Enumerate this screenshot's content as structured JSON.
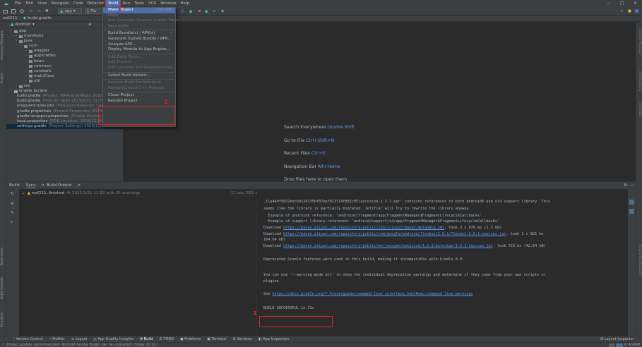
{
  "menubar": {
    "items": [
      "File",
      "Edit",
      "View",
      "Navigate",
      "Code",
      "Refactor",
      "Build",
      "Run",
      "Tools",
      "VCS",
      "Window",
      "Help"
    ],
    "active": "Build",
    "window_controls": [
      "—",
      "□",
      "✕"
    ]
  },
  "toolbar": {
    "run_config": "app",
    "device": "Pix"
  },
  "breadcrumb": {
    "project": "wxf211",
    "file": "build.gradle"
  },
  "project_panel": {
    "view": "Android",
    "tree": [
      {
        "label": "app",
        "depth": 0,
        "icon": "folder"
      },
      {
        "label": "manifests",
        "depth": 1,
        "icon": "folder"
      },
      {
        "label": "java",
        "depth": 1,
        "icon": "folder"
      },
      {
        "label": "com",
        "depth": 2,
        "icon": "package"
      },
      {
        "label": "adapter",
        "depth": 3,
        "icon": "package"
      },
      {
        "label": "application",
        "depth": 3,
        "icon": "package"
      },
      {
        "label": "bean",
        "depth": 3,
        "icon": "package"
      },
      {
        "label": "common",
        "depth": 3,
        "icon": "package"
      },
      {
        "label": "constant",
        "depth": 3,
        "icon": "package"
      },
      {
        "label": "mainClass",
        "depth": 3,
        "icon": "package"
      },
      {
        "label": "util",
        "depth": 3,
        "icon": "package"
      },
      {
        "label": "res",
        "depth": 1,
        "icon": "folder"
      },
      {
        "label": "Gradle Scripts",
        "depth": 0,
        "icon": "gradle"
      },
      {
        "label": "build.gradle",
        "depth": 1,
        "icon": "gradle",
        "note": "(Project: WRAndroidApp)  2025/1/21 12:53, 457 B"
      },
      {
        "label": "build.gradle",
        "depth": 1,
        "icon": "gradle",
        "note": "(Module :app)  2025/1/21 12:28, 5.51 kB  Moments"
      },
      {
        "label": "proguard-rules.pro",
        "depth": 1,
        "icon": "file",
        "note": "(ProGuard Rules for \":app\")  2024/11/26 11:28"
      },
      {
        "label": "gradle.properties",
        "depth": 1,
        "icon": "props",
        "note": "(Project Properties)  2024/11/26 11:58, 147 B"
      },
      {
        "label": "gradle-wrapper.properties",
        "depth": 1,
        "icon": "props",
        "note": "(Gradle Version)  2024/11/26 11:58"
      },
      {
        "label": "local.properties",
        "depth": 1,
        "icon": "props",
        "note": "(SDK Location)  2024/12/16 16:02, 468 B"
      },
      {
        "label": "settings.gradle",
        "depth": 1,
        "icon": "gradle",
        "note": "(Project Settings)  2025/1/21 12:31, 460 B  Moment",
        "selected": true
      }
    ]
  },
  "build_menu": {
    "items": [
      {
        "label": "Make Project",
        "shortcut": "Ctrl+F9",
        "enabled": true,
        "highlighted": true
      },
      {
        "label": "Make",
        "enabled": false
      },
      {
        "label": "Run Generate Sources Gradle Tasks",
        "enabled": false
      },
      {
        "label": "Recompile",
        "enabled": false
      },
      {
        "sep": true
      },
      {
        "label": "Build Bundle(s) / APK(s)",
        "enabled": true,
        "submenu": true
      },
      {
        "label": "Generate Signed Bundle / APK...",
        "enabled": true
      },
      {
        "label": "Analyze APK...",
        "enabled": true
      },
      {
        "label": "Deploy Module to App Engine...",
        "enabled": true
      },
      {
        "sep": true
      },
      {
        "label": "Edit Build Types...",
        "enabled": false
      },
      {
        "label": "Edit Flavors...",
        "enabled": false
      },
      {
        "label": "Edit Libraries and Dependencies...",
        "enabled": false
      },
      {
        "sep": true
      },
      {
        "label": "Select Build Variant...",
        "enabled": true
      },
      {
        "sep": true
      },
      {
        "label": "Analyze Build Performance",
        "enabled": false
      },
      {
        "label": "Refresh Linked C++ Projects",
        "enabled": false
      },
      {
        "sep": true
      },
      {
        "label": "Clean Project",
        "enabled": true
      },
      {
        "label": "Rebuild Project",
        "enabled": true
      }
    ]
  },
  "editor_hints": [
    {
      "text": "Search Everywhere",
      "key": "Double Shift"
    },
    {
      "text": "Go to File",
      "key": "Ctrl+Shift+N"
    },
    {
      "text": "Recent Files",
      "key": "Ctrl+E"
    },
    {
      "text": "Navigation Bar",
      "key": "Alt+Home"
    },
    {
      "text": "Drop files here to open them",
      "key": ""
    }
  ],
  "build_panel": {
    "tabs": [
      "Build:",
      "Sync",
      "Build Output"
    ],
    "tree_item": "wxf211: finished",
    "tree_item_detail": "At 2025/1/21 12:53 with 35 warnings",
    "tree_item_time": "11 sec, 851 ms"
  },
  "console": {
    "lines": [
      {
        "text": ".1\\a44df9822edcb9124235bf07bef813714fd81c05\\autosize-1.2.1.aar' contains references to both AndroidX and old support library. This"
      },
      {
        "text": "seems like the library is partially migrated. Jetifier will try to rewrite the library anyway."
      },
      {
        "text": "  Example of androidX reference: 'androidx/fragment/app/FragmentManager$FragmentLifecycleCallbacks'"
      },
      {
        "text": "  Example of support library reference: 'android/support/v4/app/FragmentManager$FragmentLifecycleCallbacks'"
      },
      {
        "pre": "Download ",
        "link": "https://maven.aliyun.com/repository/public/junit/junit/maven-metadata.xml",
        "post": ", took 3 s 970 ms (1.3 kB)"
      },
      {
        "pre": "Download ",
        "link": "https://maven.aliyun.com/repository/public/com/google/android/flexbox/2.0.1/flexbox-2.0.1-sources.jar",
        "post": ", took 1 s 921 ms"
      },
      {
        "text": "(64.04 kB)"
      },
      {
        "pre": "Download ",
        "link": "https://maven.aliyun.com/repository/public/me/jessyan/autosize/1.2.1/autosize-1.2.1-sources.jar",
        "post": ", took 723 ms (42.64 kB)"
      },
      {
        "text": ""
      },
      {
        "text": "Deprecated Gradle features were used in this build, making it incompatible with Gradle 8.0."
      },
      {
        "text": ""
      },
      {
        "text": "You can use '--warning-mode all' to show the individual deprecation warnings and determine if they come from your own scripts or"
      },
      {
        "text": "plugins."
      },
      {
        "text": ""
      },
      {
        "pre": "See ",
        "link": "https://docs.gradle.org/7.4/userguide/command_line_interface.html#sec:command_line_warnings",
        "post": ""
      },
      {
        "text": ""
      },
      {
        "text": "BUILD SUCCESSFUL in 31s"
      }
    ]
  },
  "bottom_tabs": [
    "Version Control",
    "Profiler",
    "Logcat",
    "App Quality Insights",
    "Build",
    "TODO",
    "Problems",
    "Terminal",
    "Services",
    "App Inspection"
  ],
  "bottom_right": "Layout Inspector",
  "status": {
    "message": "Project update recommended: Android Gradle Plugin can be upgraded. (today 10:21)",
    "right": "of 4096M"
  },
  "annotations": [
    "1",
    "2",
    "3"
  ],
  "left_strip": [
    "Resource Manager",
    "Project",
    "Bookmarks",
    "Build Variants",
    "Structure"
  ],
  "right_strip": [
    "Device Manager",
    "Notifications",
    "Emulator",
    "Device File Explorer"
  ],
  "colors": {
    "accent": "#4b6eaf",
    "annotation": "#e02525",
    "link": "#589df6"
  }
}
